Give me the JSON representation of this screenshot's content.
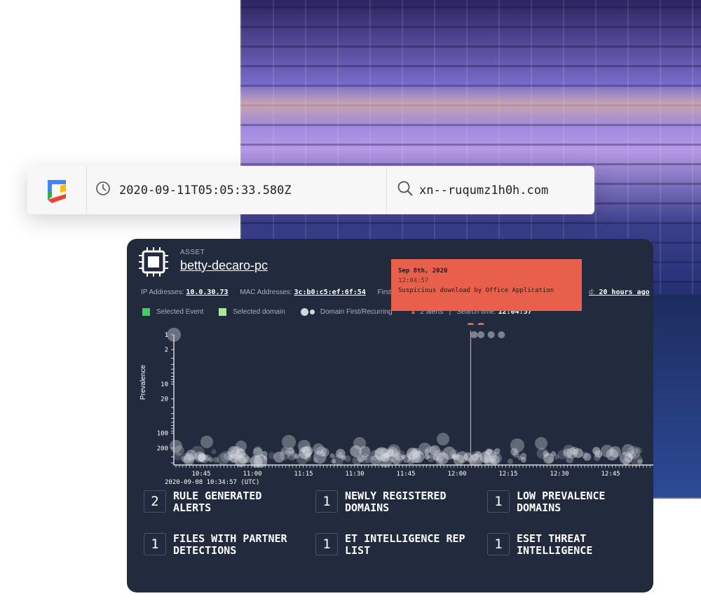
{
  "search_bar": {
    "timestamp": "2020-09-11T05:05:33.580Z",
    "query": "xn--ruqumz1h0h.com",
    "logo_icon": "chronicle-logo",
    "clock_icon": "clock-icon",
    "search_icon": "search-icon"
  },
  "asset": {
    "label": "ASSET",
    "name": "betty-decaro-pc",
    "ip_label": "IP Addresses:",
    "ip_value": "10.0.30.73",
    "mac_label": "MAC Addresses:",
    "mac_value": "3c:b0:c5:ef:6f:54",
    "first_label": "First",
    "last_label": "d:",
    "last_value": "20 hours ago"
  },
  "legend": {
    "selected_event": "Selected Event",
    "selected_domain": "Selected domain",
    "domain_first_recurring": "Domain First/Recurring",
    "alerts": "2 alerts",
    "search_time_label": "Search time:",
    "search_time_value": "12:04:57",
    "colors": {
      "selected_event": "#4cc764",
      "selected_domain": "#a8e6a0",
      "alert": "#e8604c"
    }
  },
  "tooltip": {
    "date": "Sep 8th, 2020",
    "time": "12:04:57",
    "description": "Suspicious download by Office Application"
  },
  "chart_data": {
    "type": "scatter",
    "ylabel": "Prevalence",
    "ytick_labels": [
      "1",
      "2",
      "10",
      "20",
      "100",
      "200"
    ],
    "xtick_labels": [
      "10:45",
      "11:00",
      "11:15",
      "11:30",
      "11:45",
      "12:00",
      "12:15",
      "12:30",
      "12:45"
    ],
    "x_origin_label": "2020-09-08 10:34:57 (UTC)",
    "y_scale": "log",
    "alert_times": [
      "12:04:57",
      "12:07"
    ],
    "top_points": [
      {
        "x": "10:37",
        "y": 1,
        "size": "large"
      },
      {
        "x": "12:05",
        "y": 1,
        "size": "small"
      },
      {
        "x": "12:07",
        "y": 1,
        "size": "small"
      },
      {
        "x": "12:10",
        "y": 1,
        "size": "small"
      },
      {
        "x": "12:13",
        "y": 1,
        "size": "small"
      }
    ]
  },
  "stats": [
    {
      "count": "2",
      "label": "RULE GENERATED ALERTS"
    },
    {
      "count": "1",
      "label": "NEWLY REGISTERED DOMAINS"
    },
    {
      "count": "1",
      "label": "LOW PREVALENCE DOMAINS"
    },
    {
      "count": "1",
      "label": "FILES WITH PARTNER DETECTIONS"
    },
    {
      "count": "1",
      "label": "ET INTELLIGENCE REP LIST"
    },
    {
      "count": "1",
      "label": "ESET THREAT INTELLIGENCE"
    }
  ]
}
